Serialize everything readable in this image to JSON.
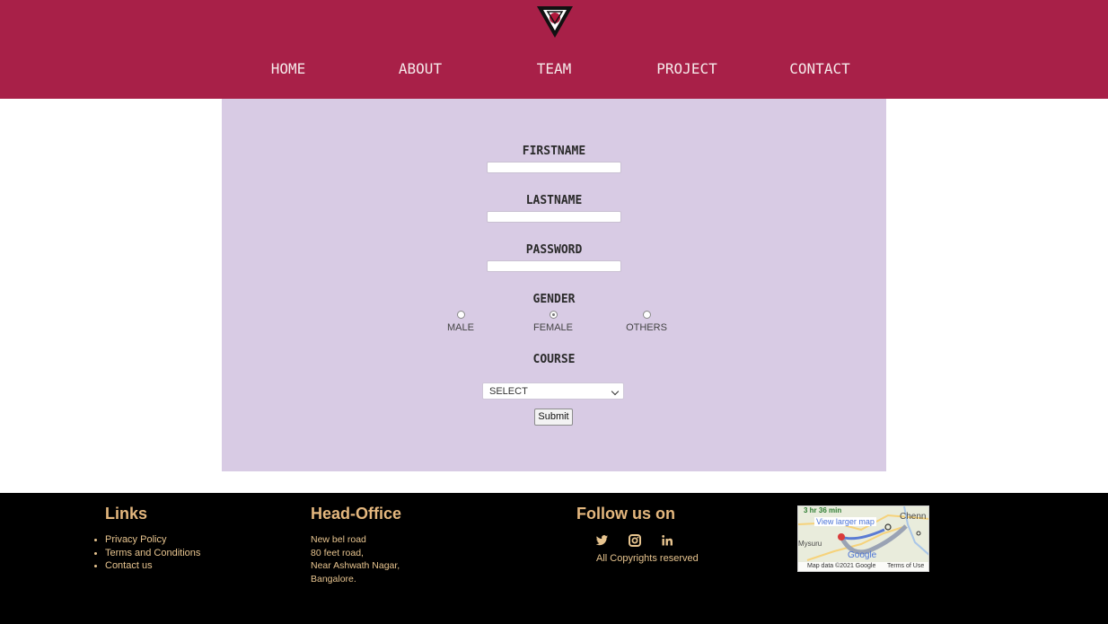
{
  "header": {
    "nav": [
      "HOME",
      "ABOUT",
      "TEAM",
      "PROJECT",
      "CONTACT"
    ]
  },
  "form": {
    "firstname_label": "FIRSTNAME",
    "lastname_label": "LASTNAME",
    "password_label": "PASSWORD",
    "gender_label": "GENDER",
    "gender_options": [
      "MALE",
      "FEMALE",
      "OTHERS"
    ],
    "gender_selected": "FEMALE",
    "course_label": "COURSE",
    "course_selected": "SELECT",
    "submit_label": "Submit"
  },
  "footer": {
    "links": {
      "heading": "Links",
      "items": [
        "Privacy Policy",
        "Terms and Conditions",
        "Contact us"
      ]
    },
    "office": {
      "heading": "Head-Office",
      "lines": [
        "New bel road",
        "80 feet road,",
        "Near Ashwath Nagar,",
        "Bangalore."
      ]
    },
    "social": {
      "heading": "Follow us on",
      "icons": [
        "twitter-icon",
        "instagram-icon",
        "linkedin-icon"
      ],
      "copyright": "All Copyrights reserved"
    },
    "map": {
      "view_larger": "View larger map",
      "route_time": "3 hr 36 min",
      "place_1": "Chenn",
      "place_2": "Mysuru",
      "brand": "Google",
      "attribution": "Map data ©2021 Google",
      "terms": "Terms of Use"
    }
  },
  "colors": {
    "header": "#a82048",
    "form_panel": "#d8cbe4",
    "footer": "#000000",
    "footer_text": "#e7c48f"
  }
}
